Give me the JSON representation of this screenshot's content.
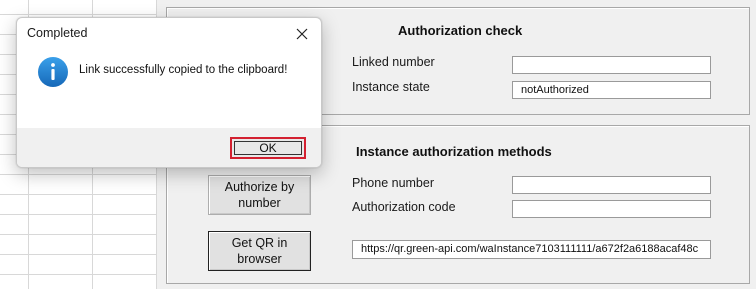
{
  "dialog": {
    "title": "Completed",
    "message": "Link successfully copied to the clipboard!",
    "ok_label": "OK"
  },
  "auth_check": {
    "title": "Authorization check",
    "linked_number_label": "Linked number",
    "linked_number_value": "",
    "instance_state_label": "Instance state",
    "instance_state_value": "notAuthorized"
  },
  "auth_methods": {
    "title": "Instance authorization methods",
    "authorize_by_number_label": "Authorize by number",
    "get_qr_label": "Get QR in browser",
    "phone_number_label": "Phone number",
    "phone_number_value": "",
    "authorization_code_label": "Authorization code",
    "authorization_code_value": "",
    "qr_link_value": "https://qr.green-api.com/waInstance7103111111/a672f2a6188acaf48c"
  },
  "colors": {
    "info_icon": "#1a7fd4",
    "highlight": "#d32030"
  }
}
